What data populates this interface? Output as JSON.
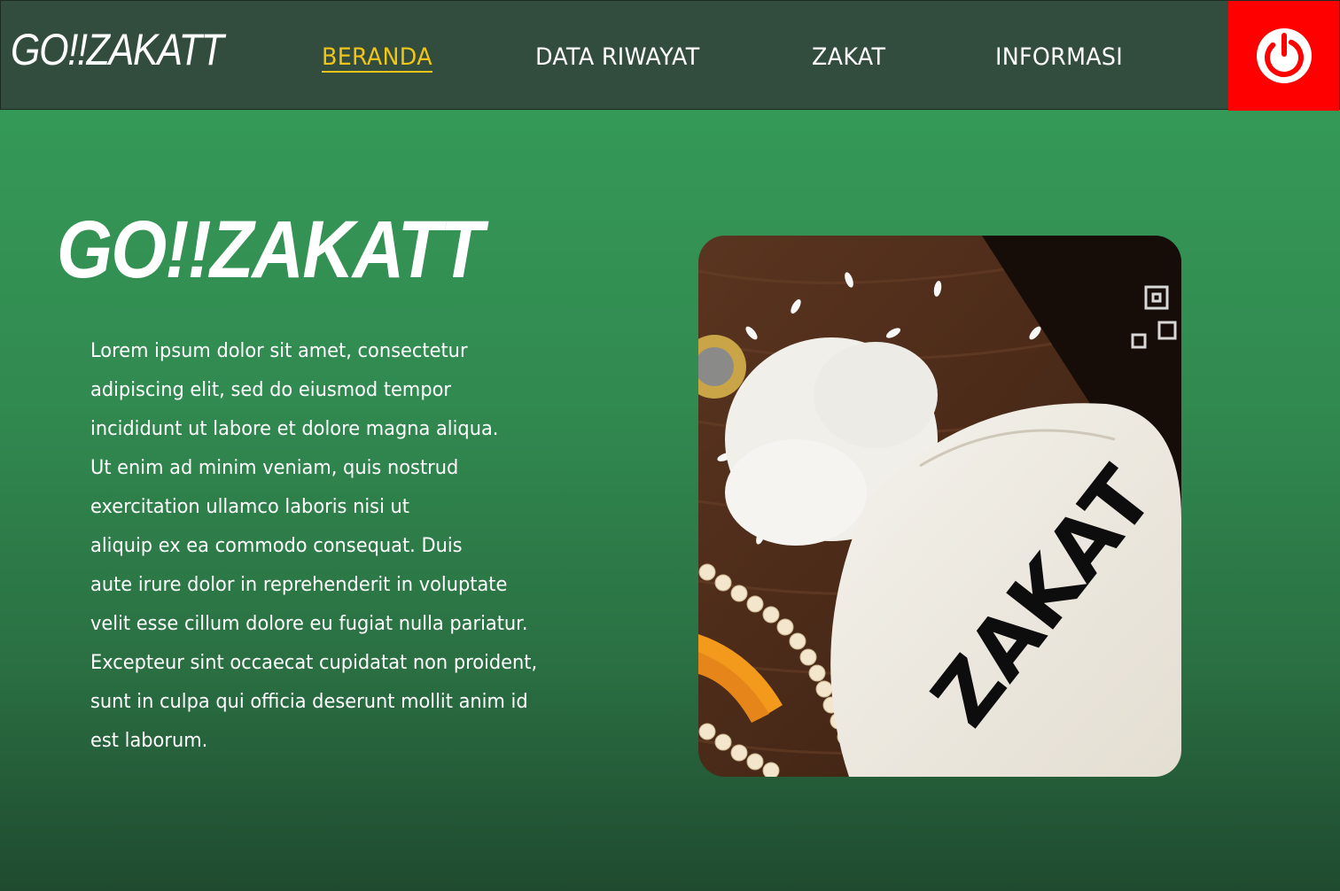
{
  "app": {
    "brand": "GO!!ZAKATT"
  },
  "nav": {
    "items": [
      {
        "label": "BERANDA",
        "active": true
      },
      {
        "label": "DATA RIWAYAT",
        "active": false
      },
      {
        "label": "ZAKAT",
        "active": false
      },
      {
        "label": "INFORMASI",
        "active": false
      }
    ],
    "power_icon": "power-icon"
  },
  "hero": {
    "title": "GO!!ZAKATT",
    "body": " Lorem ipsum dolor sit amet, consectetur\nadipiscing elit, sed do eiusmod tempor\nincididunt ut labore et dolore magna aliqua.\nUt enim ad minim veniam, quis nostrud\nexercitation ullamco laboris nisi ut\naliquip ex ea commodo consequat. Duis\n aute irure dolor in reprehenderit in voluptate\nvelit esse cillum dolore eu fugiat nulla pariatur.\nExcepteur sint occaecat cupidatat non proident,\nsunt in culpa qui officia deserunt mollit anim id\nest laborum.",
    "image_label": "ZAKAT"
  },
  "colors": {
    "navbar": "#324d3e",
    "active_link": "#f2c417",
    "power_button": "#ff0000",
    "background_top": "#369e5a",
    "background_bottom": "#1f4a2f"
  }
}
